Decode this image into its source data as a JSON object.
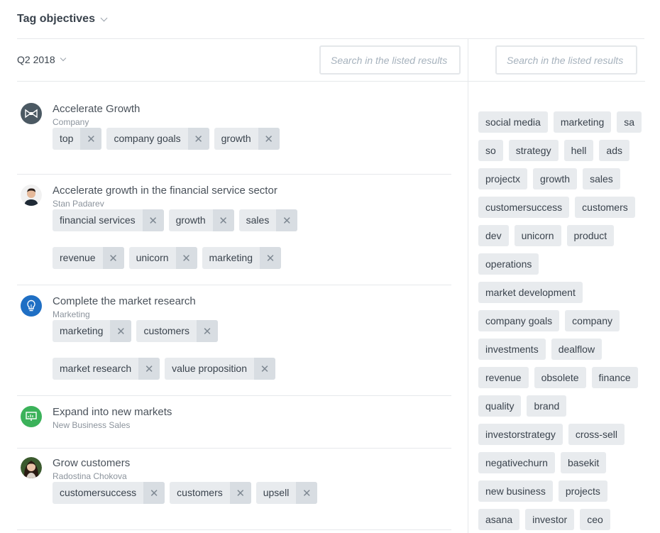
{
  "header": {
    "title": "Tag objectives"
  },
  "toolbar": {
    "quarter": "Q2 2018",
    "search_placeholder": "Search in the listed results"
  },
  "right_toolbar": {
    "search_placeholder": "Search in the listed results"
  },
  "objectives": [
    {
      "title": "Accelerate Growth",
      "subtitle": "Company",
      "icon": "bowtie-icon",
      "tags": [
        "top",
        "company goals",
        "growth"
      ]
    },
    {
      "title": "Accelerate growth in the financial service sector",
      "subtitle": "Stan Padarev",
      "icon": "avatar-man",
      "tags": [
        "financial services",
        "growth",
        "sales",
        "revenue",
        "unicorn",
        "marketing"
      ]
    },
    {
      "title": "Complete the market research",
      "subtitle": "Marketing",
      "icon": "lightbulb-icon",
      "tags": [
        "marketing",
        "customers",
        "market research",
        "value proposition"
      ]
    },
    {
      "title": "Expand into new markets",
      "subtitle": "New Business Sales",
      "icon": "presentation-icon",
      "tags": []
    },
    {
      "title": "Grow customers",
      "subtitle": "Radostina Chokova",
      "icon": "avatar-woman",
      "tags": [
        "customersuccess",
        "customers",
        "upsell"
      ]
    }
  ],
  "tag_cloud": [
    "social media",
    "marketing",
    "sa",
    "so",
    "strategy",
    "hell",
    "ads",
    "projectx",
    "growth",
    "sales",
    "customersuccess",
    "customers",
    "dev",
    "unicorn",
    "product",
    "operations",
    "market development",
    "company goals",
    "company",
    "investments",
    "dealflow",
    "revenue",
    "obsolete",
    "finance",
    "quality",
    "brand",
    "investorstrategy",
    "cross-sell",
    "negativechurn",
    "basekit",
    "new business",
    "projects",
    "asana",
    "investor",
    "ceo"
  ],
  "colors": {
    "icon_dark": "#4b5963",
    "icon_blue": "#1f6fc4",
    "icon_green": "#3bb25a",
    "tag_bg": "#e8ebee",
    "tag_x_bg": "#d8dde2"
  }
}
